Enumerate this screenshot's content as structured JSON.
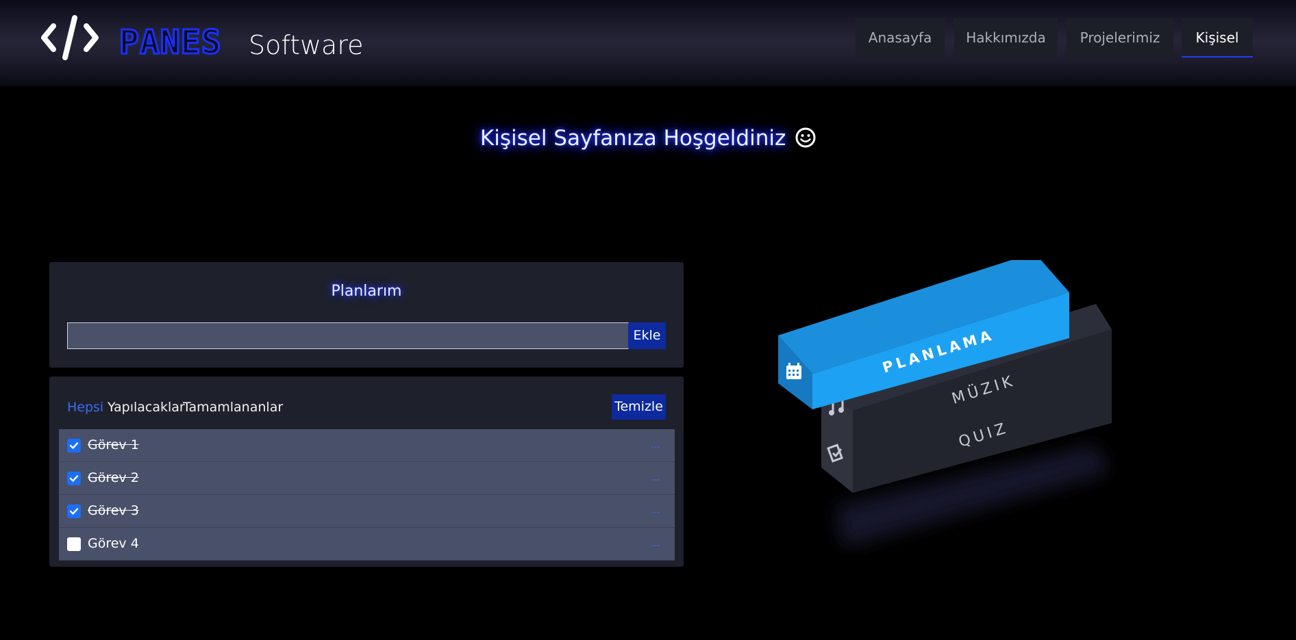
{
  "brand": {
    "name": "PANES",
    "subtitle": "Software",
    "logo_icon": "code-icon"
  },
  "nav": {
    "items": [
      {
        "label": "Anasayfa",
        "active": false
      },
      {
        "label": "Hakkımızda",
        "active": false
      },
      {
        "label": "Projelerimiz",
        "active": false
      },
      {
        "label": "Kişisel",
        "active": true
      }
    ]
  },
  "welcome": {
    "text": "Kişisel Sayfanıza Hoşgeldiniz",
    "icon": "smiley-icon"
  },
  "plans": {
    "title": "Planlarım",
    "input_value": "",
    "add_label": "Ekle"
  },
  "tasks": {
    "filters": [
      {
        "label": "Hepsi",
        "active": true
      },
      {
        "label": "Yapılacaklar",
        "active": false
      },
      {
        "label": "Tamamlananlar",
        "active": false
      }
    ],
    "clear_label": "Temizle",
    "menu_glyph": "...",
    "items": [
      {
        "label": "Görev 1",
        "done": true
      },
      {
        "label": "Görev 2",
        "done": true
      },
      {
        "label": "Görev 3",
        "done": true
      },
      {
        "label": "Görev 4",
        "done": false
      }
    ]
  },
  "box": {
    "faces": [
      {
        "label": "PLANLAMA",
        "icon": "calendar-icon"
      },
      {
        "label": "MÜZIK",
        "icon": "music-icon"
      },
      {
        "label": "QUIZ",
        "icon": "quiz-icon"
      }
    ]
  },
  "colors": {
    "accent": "#1930ff",
    "button": "#0d2a9e",
    "link": "#3a6cf4",
    "planlama": "#1a9bf0",
    "box_dark": "#22252e"
  }
}
